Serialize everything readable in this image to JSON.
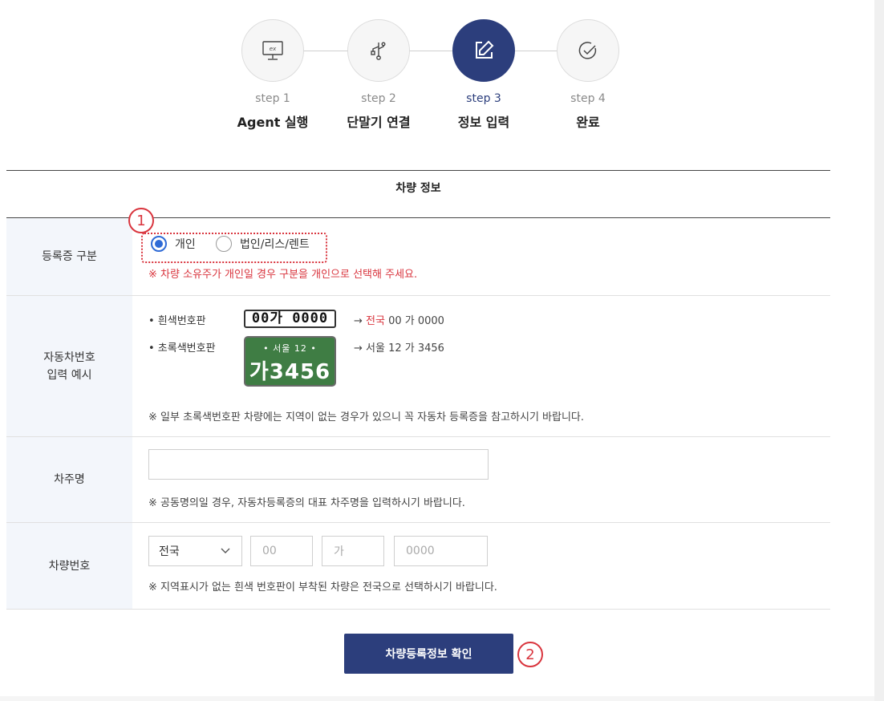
{
  "steps": [
    {
      "num": "step 1",
      "name": "Agent 실행",
      "icon": "monitor-ex-icon",
      "active": false
    },
    {
      "num": "step 2",
      "name": "단말기 연결",
      "icon": "usb-icon",
      "active": false
    },
    {
      "num": "step 3",
      "name": "정보 입력",
      "icon": "edit-icon",
      "active": true
    },
    {
      "num": "step 4",
      "name": "완료",
      "icon": "check-circle-icon",
      "active": false
    }
  ],
  "section": {
    "title": "차량 정보"
  },
  "registration_type": {
    "label": "등록증 구분",
    "marker": "1",
    "options": [
      {
        "label": "개인",
        "checked": true
      },
      {
        "label": "법인/리스/렌트",
        "checked": false
      }
    ],
    "warning": "※ 차량 소유주가 개인일 경우 구분을 개인으로 선택해 주세요."
  },
  "plate_example": {
    "label_line1": "자동차번호",
    "label_line2": "입력 예시",
    "white_label": "• 흰색번호판",
    "white_plate": "00가 0000",
    "white_arrow": "→",
    "white_region": "전국",
    "white_result": " 00 가 0000",
    "green_label": "• 초록색번호판",
    "green_plate_top": "•  서울 12  •",
    "green_plate_bottom": "가3456",
    "green_result": "→ 서울 12 가 3456",
    "note": "※ 일부 초록색번호판 차량에는 지역이 없는 경우가 있으니 꼭 자동차 등록증을 참고하시기 바랍니다."
  },
  "owner": {
    "label": "차주명",
    "value": "",
    "note": "※ 공동명의일 경우, 자동차등록증의 대표 차주명을 입력하시기 바랍니다."
  },
  "vehicle_number": {
    "label": "차량번호",
    "region_selected": "전국",
    "placeholder_num1": "00",
    "placeholder_char": "가",
    "placeholder_num2": "0000",
    "note": "※ 지역표시가 없는 흰색 번호판이 부착된 차량은 전국으로 선택하시기 바랍니다."
  },
  "confirm": {
    "label": "차량등록정보 확인",
    "marker": "2"
  },
  "colors": {
    "primary": "#2c3e7c",
    "warning": "#d9353e",
    "radio": "#2f6bd6",
    "green_plate": "#3f7d44"
  }
}
